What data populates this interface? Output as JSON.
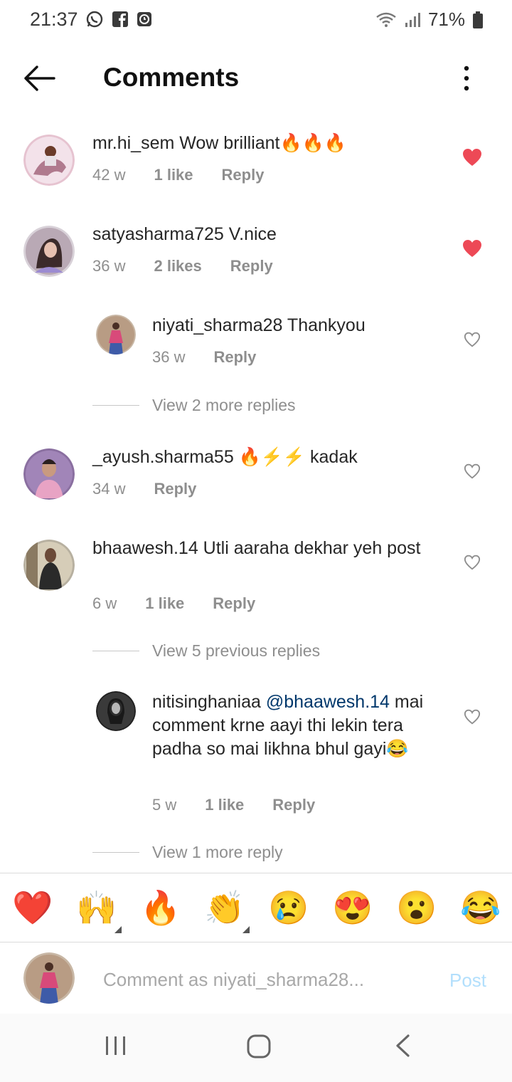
{
  "status_bar": {
    "time": "21:37",
    "battery": "71%",
    "icons": [
      "whatsapp-icon",
      "facebook-icon",
      "clock-app-icon",
      "wifi-icon",
      "signal-icon",
      "battery-icon"
    ]
  },
  "header": {
    "title": "Comments"
  },
  "comments": [
    {
      "username": "mr.hi_sem",
      "text": " Wow brilliant🔥🔥🔥",
      "time": "42 w",
      "likes": "1 like",
      "reply": "Reply",
      "liked": true
    },
    {
      "username": "satyasharma725",
      "text": " V.nice",
      "time": "36 w",
      "likes": "2 likes",
      "reply": "Reply",
      "liked": true
    },
    {
      "username": "niyati_sharma28",
      "text": " Thankyou",
      "time": "36 w",
      "reply": "Reply",
      "liked": false
    },
    {
      "username": "_ayush.sharma55",
      "text": " 🔥⚡⚡ kadak",
      "time": "34 w",
      "reply": "Reply",
      "liked": false
    },
    {
      "username": "bhaawesh.14",
      "text": " Utli aaraha dekhar yeh post",
      "time": "6 w",
      "likes": "1 like",
      "reply": "Reply",
      "liked": false
    },
    {
      "username": "nitisinghaniaa",
      "mention": " @bhaawesh.14",
      "text": " mai comment krne aayi thi lekin tera padha so mai likhna bhul gayi😂",
      "time": "5 w",
      "likes": "1 like",
      "reply": "Reply",
      "liked": false
    }
  ],
  "view_more": {
    "first": "View 2 more replies",
    "second": "View 5 previous replies",
    "third": "View 1 more reply"
  },
  "emoji_bar": [
    "❤️",
    "🙌",
    "🔥",
    "👏",
    "😢",
    "😍",
    "😮",
    "😂"
  ],
  "input": {
    "placeholder": "Comment as niyati_sharma28...",
    "post_label": "Post"
  },
  "colors": {
    "liked_heart": "#ed4956",
    "post_disabled": "#b2dffc",
    "mention": "#00376b",
    "meta_gray": "#8e8e8e"
  }
}
